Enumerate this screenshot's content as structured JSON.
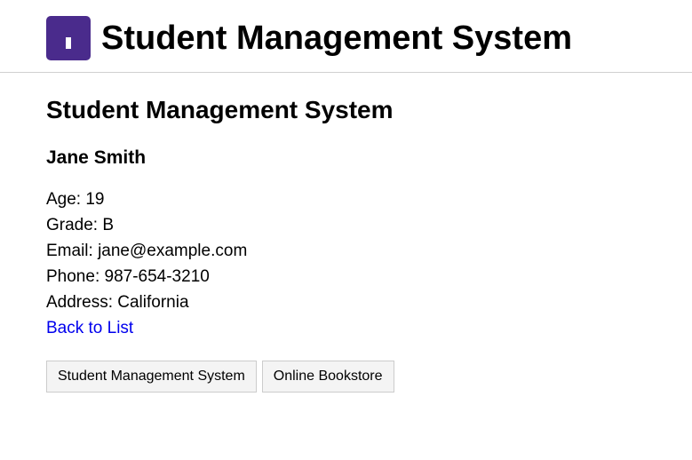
{
  "header": {
    "logo_icon": "app-logo-icon",
    "logo_color": "#4a2b8c",
    "title": "Student Management System"
  },
  "main": {
    "title": "Student Management System",
    "student": {
      "name": "Jane Smith",
      "age": "Age: 19",
      "grade": "Grade: B",
      "email": "Email: jane@example.com",
      "phone": "Phone: 987-654-3210",
      "address": "Address: California"
    },
    "back_link": "Back to List"
  },
  "buttons": {
    "student_management": "Student Management System",
    "online_bookstore": "Online Bookstore"
  },
  "colors": {
    "link": "#0000ee",
    "button_bg": "#f4f4f4",
    "button_border": "#cccccc"
  }
}
